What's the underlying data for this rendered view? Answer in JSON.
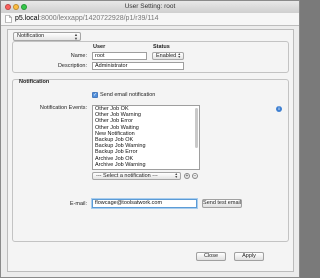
{
  "window": {
    "title": "User Setting: root"
  },
  "address_bar": {
    "host": "p5.local",
    "path": ":8000/lexxapp/1420722928/p1/r39/114"
  },
  "section_select": {
    "value": "Notification"
  },
  "user_section": {
    "header_user": "User",
    "header_status": "Status",
    "name_label": "Name:",
    "name_value": "root",
    "status_value": "Enabled",
    "description_label": "Description:",
    "description_value": "Administrator"
  },
  "notification_section": {
    "title": "Notification",
    "send_email_label": "Send email notification",
    "send_email_checked": true,
    "events_label": "Notification Events:",
    "events": [
      "Other Job OK",
      "Other Job Warning",
      "Other Job Error",
      "Other Job Waiting",
      "New Notification",
      "Backup Job OK",
      "Backup Job Warning",
      "Backup Job Error",
      "Archive Job OK",
      "Archive Job Warning"
    ],
    "select_notification_placeholder": "--- Select a notification ---",
    "add_symbol": "+",
    "remove_symbol": "−",
    "email_label": "E-mail:",
    "email_value": "flowcage@toolsatwork.com",
    "send_test_label": "Send test email"
  },
  "footer": {
    "close_label": "Close",
    "apply_label": "Apply"
  },
  "colors": {
    "accent": "#4f8fdc",
    "focus": "#5b9bd6"
  }
}
